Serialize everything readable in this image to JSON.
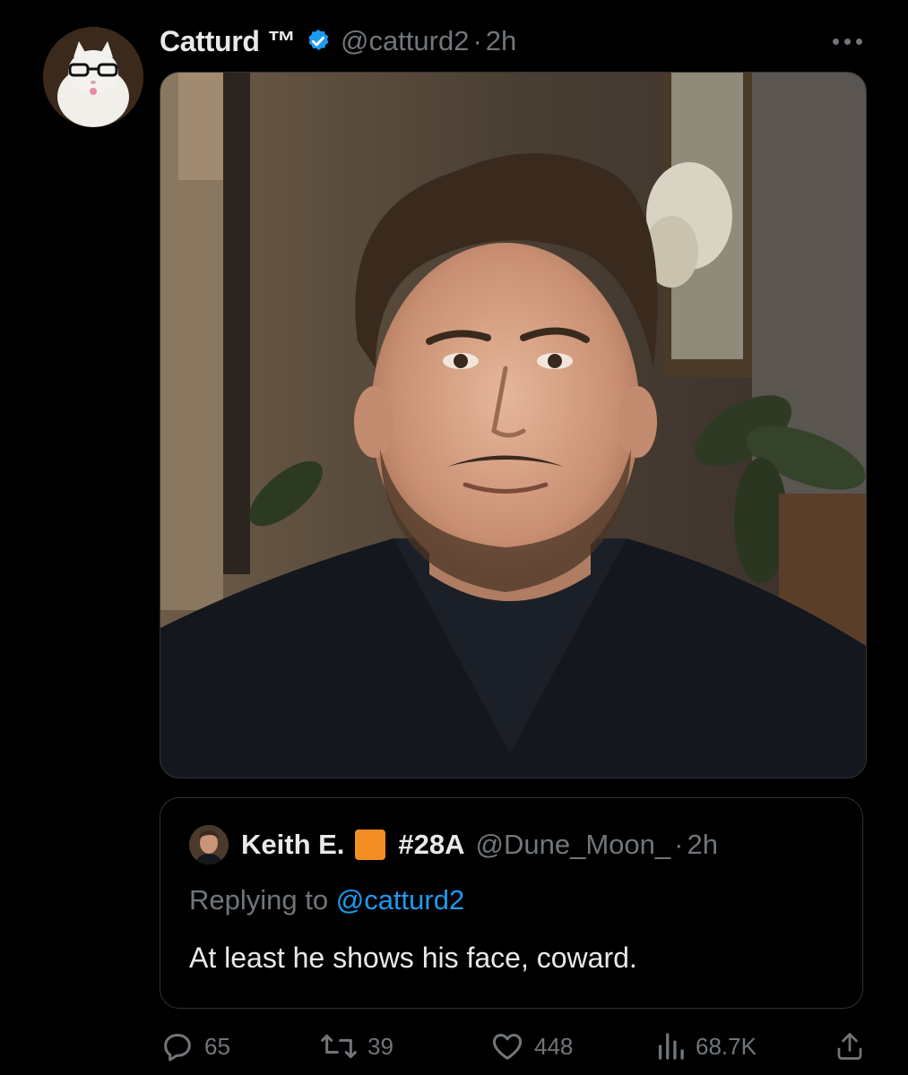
{
  "tweet": {
    "display_name": "Catturd ™",
    "handle": "@catturd2",
    "separator": "·",
    "time": "2h",
    "verified_icon": "verified-badge-icon",
    "more_icon": "more-icon",
    "avatar_icon": "cat-avatar"
  },
  "quote": {
    "name": "Keith E.",
    "tag": "#28A",
    "handle": "@Dune_Moon_",
    "separator": "·",
    "time": "2h",
    "reply_prefix": "Replying to",
    "reply_mention": "@catturd2",
    "text": "At least he shows his face, coward.",
    "square_color": "#f38e24"
  },
  "actions": {
    "replies": "65",
    "retweets": "39",
    "likes": "448",
    "views": "68.7K"
  },
  "colors": {
    "background": "#000000",
    "text": "#e7e9ea",
    "muted": "#71767b",
    "link": "#1d9bf0",
    "border": "#2f3336"
  }
}
